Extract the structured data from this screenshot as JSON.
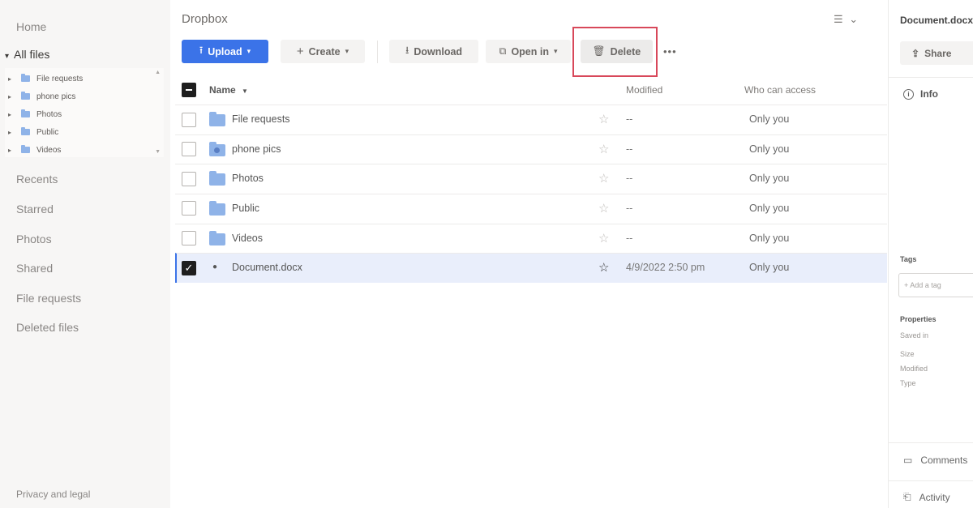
{
  "sidebar": {
    "home": "Home",
    "all_files": "All files",
    "all_files_caret": "▾",
    "tree": [
      {
        "label": "File requests"
      },
      {
        "label": "phone pics"
      },
      {
        "label": "Photos"
      },
      {
        "label": "Public"
      },
      {
        "label": "Videos"
      }
    ],
    "tree_caret": "▸",
    "links": [
      "Recents",
      "Starred",
      "Photos",
      "Shared",
      "File requests",
      "Deleted files"
    ],
    "footer": "Privacy and legal"
  },
  "main": {
    "title": "Dropbox",
    "view_toggle": "☰ ⌄",
    "toolbar": {
      "upload": "Upload",
      "create": "Create",
      "download": "Download",
      "open_in": "Open in",
      "delete": "Delete",
      "more": "•••"
    },
    "columns": {
      "name": "Name",
      "sort_arrow": "▼",
      "modified": "Modified",
      "access": "Who can access"
    },
    "rows": [
      {
        "name": "File requests",
        "modified": "--",
        "access": "Only you"
      },
      {
        "name": "phone pics",
        "modified": "--",
        "access": "Only you"
      },
      {
        "name": "Photos",
        "modified": "--",
        "access": "Only you"
      },
      {
        "name": "Public",
        "modified": "--",
        "access": "Only you"
      },
      {
        "name": "Videos",
        "modified": "--",
        "access": "Only you"
      },
      {
        "name": "Document.docx",
        "modified": "4/9/2022 2:50 pm",
        "access": "Only you"
      }
    ]
  },
  "right_panel": {
    "title": "Document.docx",
    "share": "Share",
    "info": "Info",
    "tags_label": "Tags",
    "tag_placeholder": "+ Add a tag",
    "properties_label": "Properties",
    "properties": [
      "Saved in",
      "Size",
      "Modified",
      "Type"
    ],
    "comments": "Comments",
    "activity": "Activity"
  },
  "colors": {
    "accent": "#3b73e8",
    "highlight_box": "#d8485a",
    "folder": "#8fb3e8"
  }
}
